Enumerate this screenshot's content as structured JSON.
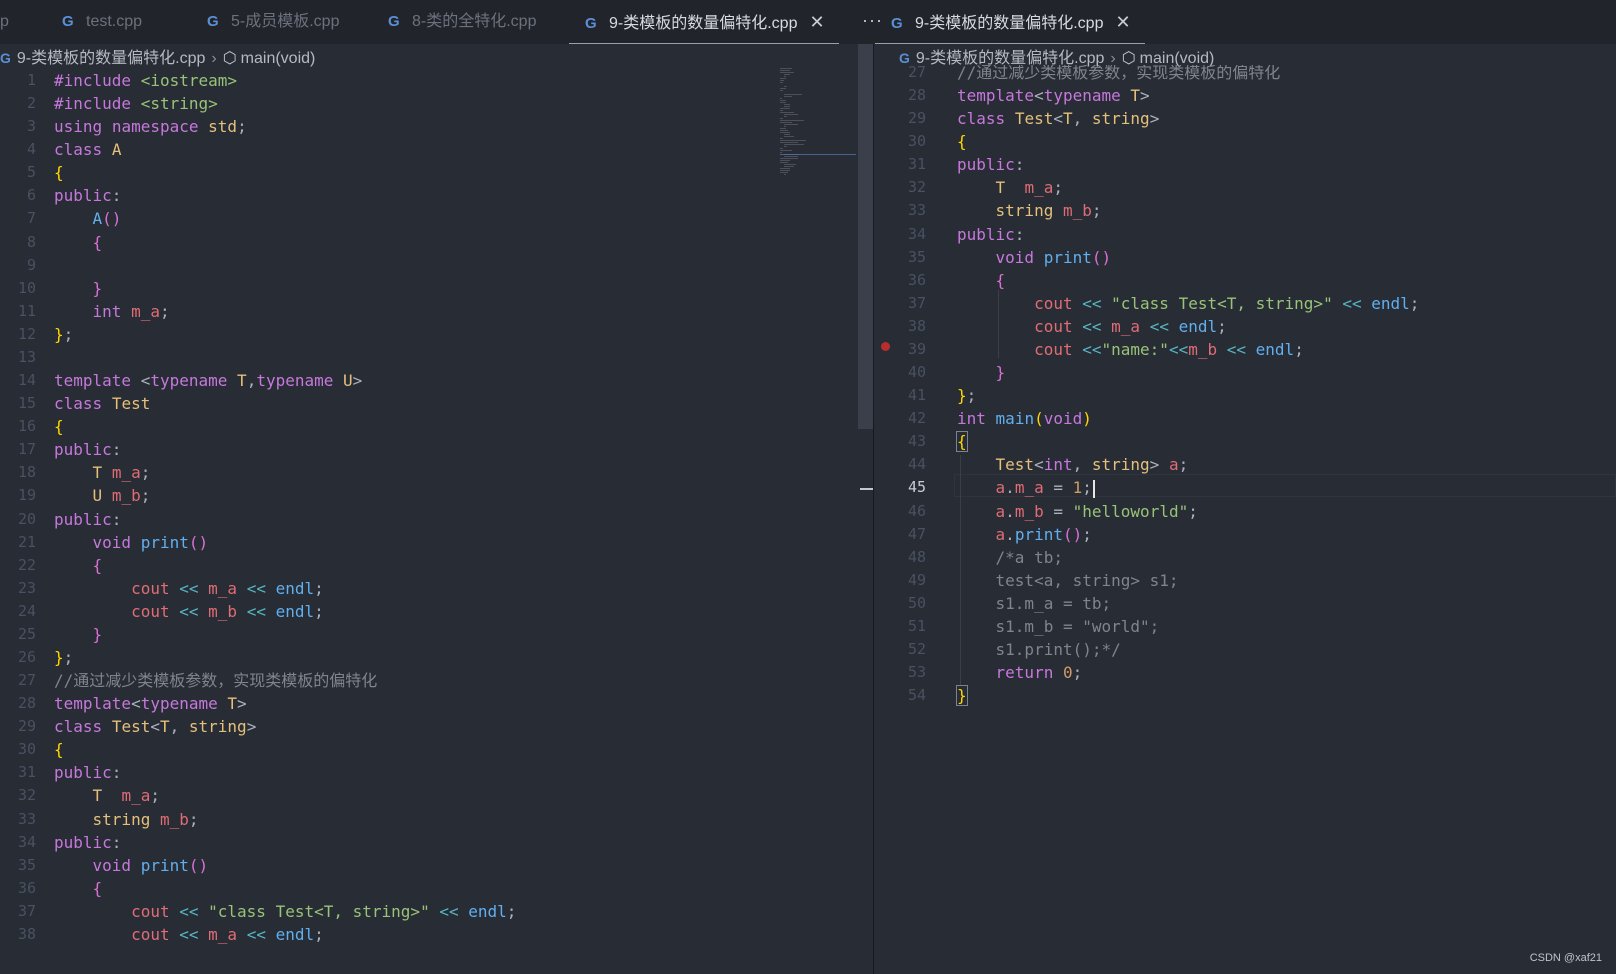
{
  "tabs_left": [
    {
      "label": "p",
      "icon": "",
      "active": false
    },
    {
      "label": "test.cpp",
      "icon": "cpp-icon",
      "active": false
    },
    {
      "label": "5-成员模板.cpp",
      "icon": "cpp-icon",
      "active": false
    },
    {
      "label": "8-类的全特化.cpp",
      "icon": "cpp-icon",
      "active": false
    },
    {
      "label": "9-类模板的数量偏特化.cpp",
      "icon": "cpp-icon",
      "active": true
    }
  ],
  "tabs_right": [
    {
      "label": "9-类模板的数量偏特化.cpp",
      "icon": "cpp-icon",
      "active": true
    }
  ],
  "more_label": "···",
  "close_glyph": "✕",
  "breadcrumb": {
    "file": "9-类模板的数量偏特化.cpp",
    "symbol": "main(void)"
  },
  "left_lines": [
    [
      [
        "kw",
        "#include"
      ],
      [
        "pl",
        " "
      ],
      [
        "str",
        "<iostream>"
      ]
    ],
    [
      [
        "kw",
        "#include"
      ],
      [
        "pl",
        " "
      ],
      [
        "str",
        "<string>"
      ]
    ],
    [
      [
        "kw",
        "using"
      ],
      [
        "pl",
        " "
      ],
      [
        "kw",
        "namespace"
      ],
      [
        "pl",
        " "
      ],
      [
        "ty",
        "std"
      ],
      [
        "pl",
        ";"
      ]
    ],
    [
      [
        "kw",
        "class"
      ],
      [
        "pl",
        " "
      ],
      [
        "ty",
        "A"
      ]
    ],
    [
      [
        "br1",
        "{"
      ]
    ],
    [
      [
        "kw",
        "public"
      ],
      [
        "pl",
        ":"
      ]
    ],
    [
      [
        "pl",
        "    "
      ],
      [
        "fn",
        "A"
      ],
      [
        "br2",
        "()"
      ]
    ],
    [
      [
        "pl",
        "    "
      ],
      [
        "br2",
        "{"
      ]
    ],
    [],
    [
      [
        "pl",
        "    "
      ],
      [
        "br2",
        "}"
      ]
    ],
    [
      [
        "pl",
        "    "
      ],
      [
        "kw",
        "int"
      ],
      [
        "pl",
        " "
      ],
      [
        "var",
        "m_a"
      ],
      [
        "pl",
        ";"
      ]
    ],
    [
      [
        "br1",
        "}"
      ],
      [
        "pl",
        ";"
      ]
    ],
    [],
    [
      [
        "kw",
        "template"
      ],
      [
        "pl",
        " "
      ],
      [
        "pl",
        "<"
      ],
      [
        "kw",
        "typename"
      ],
      [
        "pl",
        " "
      ],
      [
        "ty",
        "T"
      ],
      [
        "pl",
        ","
      ],
      [
        "kw",
        "typename"
      ],
      [
        "pl",
        " "
      ],
      [
        "ty",
        "U"
      ],
      [
        "pl",
        ">"
      ]
    ],
    [
      [
        "kw",
        "class"
      ],
      [
        "pl",
        " "
      ],
      [
        "ty",
        "Test"
      ]
    ],
    [
      [
        "br1",
        "{"
      ]
    ],
    [
      [
        "kw",
        "public"
      ],
      [
        "pl",
        ":"
      ]
    ],
    [
      [
        "pl",
        "    "
      ],
      [
        "ty",
        "T"
      ],
      [
        "pl",
        " "
      ],
      [
        "var",
        "m_a"
      ],
      [
        "pl",
        ";"
      ]
    ],
    [
      [
        "pl",
        "    "
      ],
      [
        "ty",
        "U"
      ],
      [
        "pl",
        " "
      ],
      [
        "var",
        "m_b"
      ],
      [
        "pl",
        ";"
      ]
    ],
    [
      [
        "kw",
        "public"
      ],
      [
        "pl",
        ":"
      ]
    ],
    [
      [
        "pl",
        "    "
      ],
      [
        "kw",
        "void"
      ],
      [
        "pl",
        " "
      ],
      [
        "fn",
        "print"
      ],
      [
        "br2",
        "()"
      ]
    ],
    [
      [
        "pl",
        "    "
      ],
      [
        "br2",
        "{"
      ]
    ],
    [
      [
        "pl",
        "        "
      ],
      [
        "var",
        "cout"
      ],
      [
        "pl",
        " "
      ],
      [
        "op",
        "<<"
      ],
      [
        "pl",
        " "
      ],
      [
        "var",
        "m_a"
      ],
      [
        "pl",
        " "
      ],
      [
        "op",
        "<<"
      ],
      [
        "pl",
        " "
      ],
      [
        "fn",
        "endl"
      ],
      [
        "pl",
        ";"
      ]
    ],
    [
      [
        "pl",
        "        "
      ],
      [
        "var",
        "cout"
      ],
      [
        "pl",
        " "
      ],
      [
        "op",
        "<<"
      ],
      [
        "pl",
        " "
      ],
      [
        "var",
        "m_b"
      ],
      [
        "pl",
        " "
      ],
      [
        "op",
        "<<"
      ],
      [
        "pl",
        " "
      ],
      [
        "fn",
        "endl"
      ],
      [
        "pl",
        ";"
      ]
    ],
    [
      [
        "pl",
        "    "
      ],
      [
        "br2",
        "}"
      ]
    ],
    [
      [
        "br1",
        "}"
      ],
      [
        "pl",
        ";"
      ]
    ],
    [
      [
        "cm",
        "//通过减少类模板参数，实现类模板的偏特化"
      ]
    ],
    [
      [
        "kw",
        "template"
      ],
      [
        "pl",
        "<"
      ],
      [
        "kw",
        "typename"
      ],
      [
        "pl",
        " "
      ],
      [
        "ty",
        "T"
      ],
      [
        "pl",
        ">"
      ]
    ],
    [
      [
        "kw",
        "class"
      ],
      [
        "pl",
        " "
      ],
      [
        "ty",
        "Test"
      ],
      [
        "pl",
        "<"
      ],
      [
        "ty",
        "T"
      ],
      [
        "pl",
        ", "
      ],
      [
        "ty",
        "string"
      ],
      [
        "pl",
        ">"
      ]
    ],
    [
      [
        "br1",
        "{"
      ]
    ],
    [
      [
        "kw",
        "public"
      ],
      [
        "pl",
        ":"
      ]
    ],
    [
      [
        "pl",
        "    "
      ],
      [
        "ty",
        "T"
      ],
      [
        "pl",
        "  "
      ],
      [
        "var",
        "m_a"
      ],
      [
        "pl",
        ";"
      ]
    ],
    [
      [
        "pl",
        "    "
      ],
      [
        "ty",
        "string"
      ],
      [
        "pl",
        " "
      ],
      [
        "var",
        "m_b"
      ],
      [
        "pl",
        ";"
      ]
    ],
    [
      [
        "kw",
        "public"
      ],
      [
        "pl",
        ":"
      ]
    ],
    [
      [
        "pl",
        "    "
      ],
      [
        "kw",
        "void"
      ],
      [
        "pl",
        " "
      ],
      [
        "fn",
        "print"
      ],
      [
        "br2",
        "()"
      ]
    ],
    [
      [
        "pl",
        "    "
      ],
      [
        "br2",
        "{"
      ]
    ],
    [
      [
        "pl",
        "        "
      ],
      [
        "var",
        "cout"
      ],
      [
        "pl",
        " "
      ],
      [
        "op",
        "<<"
      ],
      [
        "pl",
        " "
      ],
      [
        "str",
        "\"class Test<T, string>\""
      ],
      [
        "pl",
        " "
      ],
      [
        "op",
        "<<"
      ],
      [
        "pl",
        " "
      ],
      [
        "fn",
        "endl"
      ],
      [
        "pl",
        ";"
      ]
    ],
    [
      [
        "pl",
        "        "
      ],
      [
        "var",
        "cout"
      ],
      [
        "pl",
        " "
      ],
      [
        "op",
        "<<"
      ],
      [
        "pl",
        " "
      ],
      [
        "var",
        "m_a"
      ],
      [
        "pl",
        " "
      ],
      [
        "op",
        "<<"
      ],
      [
        "pl",
        " "
      ],
      [
        "fn",
        "endl"
      ],
      [
        "pl",
        ";"
      ]
    ]
  ],
  "right_start": 27,
  "right_lines": [
    [
      [
        "cm",
        "//通过减少类模板参数，实现类模板的偏特化"
      ]
    ],
    [
      [
        "kw",
        "template"
      ],
      [
        "pl",
        "<"
      ],
      [
        "kw",
        "typename"
      ],
      [
        "pl",
        " "
      ],
      [
        "ty",
        "T"
      ],
      [
        "pl",
        ">"
      ]
    ],
    [
      [
        "kw",
        "class"
      ],
      [
        "pl",
        " "
      ],
      [
        "ty",
        "Test"
      ],
      [
        "pl",
        "<"
      ],
      [
        "ty",
        "T"
      ],
      [
        "pl",
        ", "
      ],
      [
        "ty",
        "string"
      ],
      [
        "pl",
        ">"
      ]
    ],
    [
      [
        "br1",
        "{"
      ]
    ],
    [
      [
        "kw",
        "public"
      ],
      [
        "pl",
        ":"
      ]
    ],
    [
      [
        "pl",
        "    "
      ],
      [
        "ty",
        "T"
      ],
      [
        "pl",
        "  "
      ],
      [
        "var",
        "m_a"
      ],
      [
        "pl",
        ";"
      ]
    ],
    [
      [
        "pl",
        "    "
      ],
      [
        "ty",
        "string"
      ],
      [
        "pl",
        " "
      ],
      [
        "var",
        "m_b"
      ],
      [
        "pl",
        ";"
      ]
    ],
    [
      [
        "kw",
        "public"
      ],
      [
        "pl",
        ":"
      ]
    ],
    [
      [
        "pl",
        "    "
      ],
      [
        "kw",
        "void"
      ],
      [
        "pl",
        " "
      ],
      [
        "fn",
        "print"
      ],
      [
        "br2",
        "()"
      ]
    ],
    [
      [
        "pl",
        "    "
      ],
      [
        "br2",
        "{"
      ]
    ],
    [
      [
        "pl",
        "        "
      ],
      [
        "var",
        "cout"
      ],
      [
        "pl",
        " "
      ],
      [
        "op",
        "<<"
      ],
      [
        "pl",
        " "
      ],
      [
        "str",
        "\"class Test<T, string>\""
      ],
      [
        "pl",
        " "
      ],
      [
        "op",
        "<<"
      ],
      [
        "pl",
        " "
      ],
      [
        "fn",
        "endl"
      ],
      [
        "pl",
        ";"
      ]
    ],
    [
      [
        "pl",
        "        "
      ],
      [
        "var",
        "cout"
      ],
      [
        "pl",
        " "
      ],
      [
        "op",
        "<<"
      ],
      [
        "pl",
        " "
      ],
      [
        "var",
        "m_a"
      ],
      [
        "pl",
        " "
      ],
      [
        "op",
        "<<"
      ],
      [
        "pl",
        " "
      ],
      [
        "fn",
        "endl"
      ],
      [
        "pl",
        ";"
      ]
    ],
    [
      [
        "pl",
        "        "
      ],
      [
        "var",
        "cout"
      ],
      [
        "pl",
        " "
      ],
      [
        "op",
        "<<"
      ],
      [
        "str",
        "\"name:\""
      ],
      [
        "op",
        "<<"
      ],
      [
        "var",
        "m_b"
      ],
      [
        "pl",
        " "
      ],
      [
        "op",
        "<<"
      ],
      [
        "pl",
        " "
      ],
      [
        "fn",
        "endl"
      ],
      [
        "pl",
        ";"
      ]
    ],
    [
      [
        "pl",
        "    "
      ],
      [
        "br2",
        "}"
      ]
    ],
    [
      [
        "br1",
        "}"
      ],
      [
        "pl",
        ";"
      ]
    ],
    [
      [
        "kw",
        "int"
      ],
      [
        "pl",
        " "
      ],
      [
        "fn",
        "main"
      ],
      [
        "br1",
        "("
      ],
      [
        "kw",
        "void"
      ],
      [
        "br1",
        ")"
      ]
    ],
    [
      [
        "br1",
        "{"
      ]
    ],
    [
      [
        "pl",
        "    "
      ],
      [
        "ty",
        "Test"
      ],
      [
        "pl",
        "<"
      ],
      [
        "kw",
        "int"
      ],
      [
        "pl",
        ", "
      ],
      [
        "ty",
        "string"
      ],
      [
        "pl",
        "> "
      ],
      [
        "var",
        "a"
      ],
      [
        "pl",
        ";"
      ]
    ],
    [
      [
        "pl",
        "    "
      ],
      [
        "var",
        "a"
      ],
      [
        "pl",
        "."
      ],
      [
        "var",
        "m_a"
      ],
      [
        "pl",
        " = "
      ],
      [
        "num",
        "1"
      ],
      [
        "pl",
        ";"
      ]
    ],
    [
      [
        "pl",
        "    "
      ],
      [
        "var",
        "a"
      ],
      [
        "pl",
        "."
      ],
      [
        "var",
        "m_b"
      ],
      [
        "pl",
        " = "
      ],
      [
        "str",
        "\"helloworld\""
      ],
      [
        "pl",
        ";"
      ]
    ],
    [
      [
        "pl",
        "    "
      ],
      [
        "var",
        "a"
      ],
      [
        "pl",
        "."
      ],
      [
        "fn",
        "print"
      ],
      [
        "br2",
        "()"
      ],
      [
        "pl",
        ";"
      ]
    ],
    [
      [
        "pl",
        "    "
      ],
      [
        "dim",
        "/*a tb;"
      ]
    ],
    [
      [
        "pl",
        "    "
      ],
      [
        "dim",
        "test<a, string> s1;"
      ]
    ],
    [
      [
        "pl",
        "    "
      ],
      [
        "dim",
        "s1.m_a = tb;"
      ]
    ],
    [
      [
        "pl",
        "    "
      ],
      [
        "dim",
        "s1.m_b = \"world\";"
      ]
    ],
    [
      [
        "pl",
        "    "
      ],
      [
        "dim",
        "s1.print();*/"
      ]
    ],
    [
      [
        "pl",
        "    "
      ],
      [
        "kw",
        "return"
      ],
      [
        "pl",
        " "
      ],
      [
        "num",
        "0"
      ],
      [
        "pl",
        ";"
      ]
    ],
    [
      [
        "br1",
        "}"
      ]
    ]
  ],
  "current_line": 45,
  "breakpoint_line": 39,
  "watermark": "CSDN @xaf21"
}
